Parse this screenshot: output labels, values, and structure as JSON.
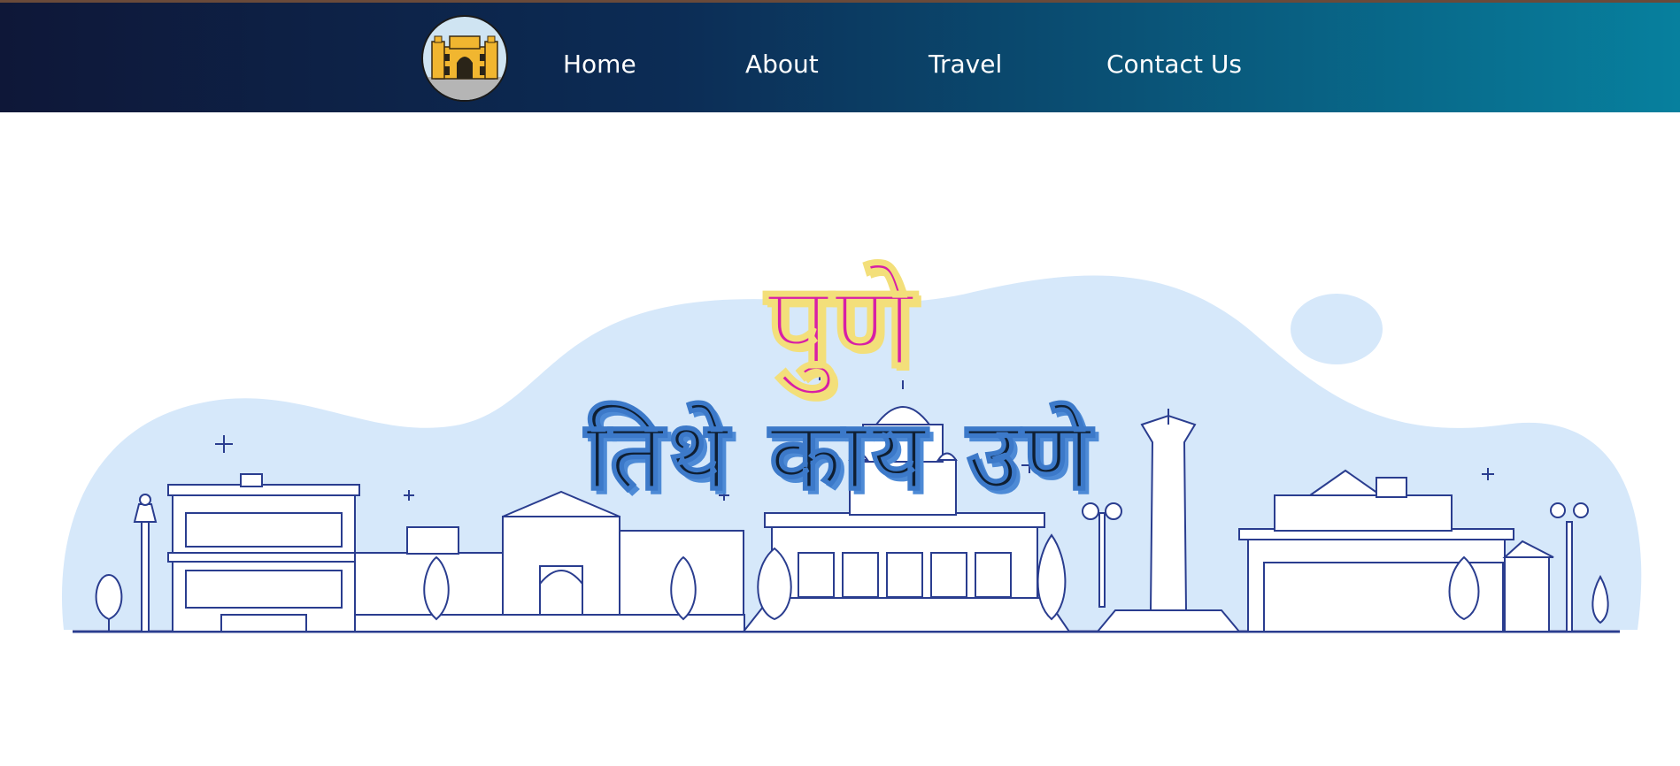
{
  "nav": {
    "logo_icon": "gateway-arch-icon",
    "items": [
      {
        "label": "Home"
      },
      {
        "label": "About"
      },
      {
        "label": "Travel"
      },
      {
        "label": "Contact Us"
      }
    ]
  },
  "hero": {
    "title": "पुणे",
    "subtitle": "तिथे काय उणे",
    "illustration": "pune-city-skyline-illustration"
  },
  "colors": {
    "navbar_left": "#0e1738",
    "navbar_right": "#07809e",
    "title_magenta": "#d81fa6",
    "title_outline": "#f3df7a",
    "subtitle_dark": "#0f1f33",
    "skyline_line": "#2a3d8f",
    "skyline_blob": "#d6e8fa"
  }
}
